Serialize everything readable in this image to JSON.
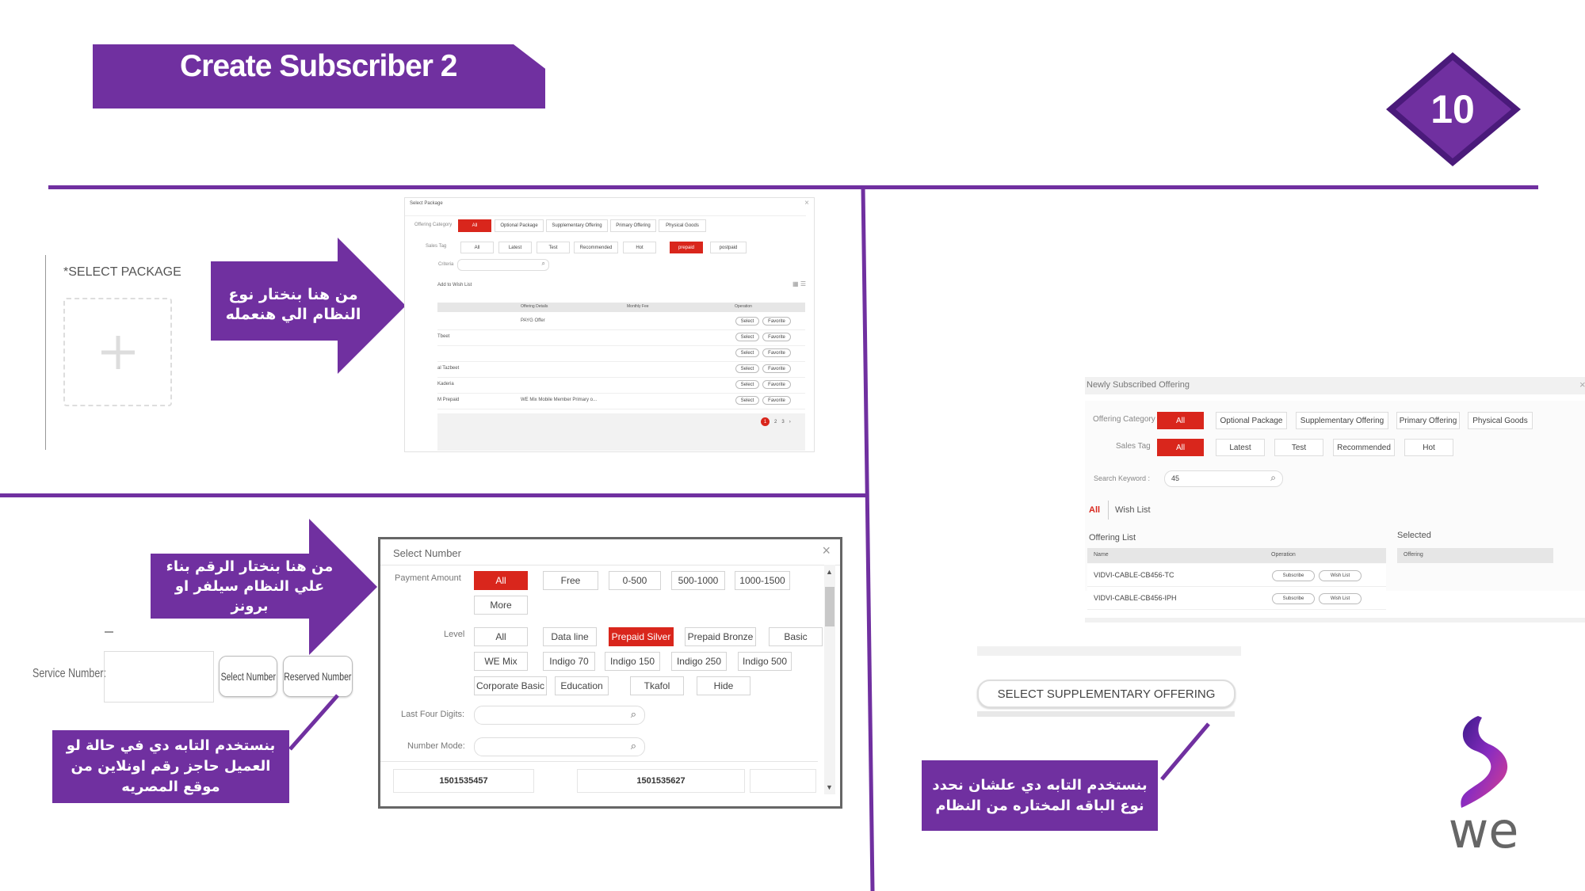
{
  "slide": {
    "title": "Create Subscriber 2",
    "page_number": "10",
    "brand_logo_text": "we",
    "colors": {
      "accent": "#7030a0",
      "red": "#d9261c"
    }
  },
  "select_package": {
    "label": "*SELECT PACKAGE",
    "arrow_note": "من هنا بنختار نوع النظام الي هنعمله"
  },
  "package_dialog": {
    "title": "Select Package",
    "offering_category_label": "Offering Category",
    "offering_categories": [
      "All",
      "Optional Package",
      "Supplementary Offering",
      "Primary Offering",
      "Physical Goods"
    ],
    "sales_tag_label": "Sales Tag",
    "sales_tags": [
      "All",
      "Latest",
      "Test",
      "Recommended",
      "Hot",
      "prepaid",
      "postpaid"
    ],
    "criteria_label": "Criteria",
    "add_to_wish_list": "Add to Wish List",
    "columns": [
      "Offering Details",
      "Monthly Fee",
      "Operation"
    ],
    "rows": [
      {
        "name": "",
        "details": "PAYG Offer"
      },
      {
        "name": "Tbeet",
        "details": ""
      },
      {
        "name": "",
        "details": ""
      },
      {
        "name": "al Tazbeet",
        "details": ""
      },
      {
        "name": "Kaderia",
        "details": ""
      },
      {
        "name": "M Prepaid",
        "details": "WE Mix Mobile Member Primary o..."
      }
    ],
    "row_buttons": [
      "Select",
      "Favorite"
    ],
    "pages": [
      "1",
      "2",
      "3"
    ]
  },
  "service_number": {
    "label": "Service Number:",
    "select_number_btn": "Select Number",
    "reserved_number_btn": "Reserved Number",
    "arrow_note": "من هنا بنختار الرقم بناء علي النظام سيلفر او برونز",
    "note": "بنستخدم التابه دي في حالة لو العميل حاجز رقم اونلاين من موقع المصريه"
  },
  "number_dialog": {
    "title": "Select Number",
    "payment_amount_label": "Payment Amount",
    "payment_amounts": [
      "All",
      "Free",
      "0-500",
      "500-1000",
      "1000-1500",
      "More"
    ],
    "level_label": "Level",
    "levels": [
      "All",
      "Data line",
      "Prepaid Silver",
      "Prepaid Bronze",
      "Basic",
      "WE Mix",
      "Indigo 70",
      "Indigo 150",
      "Indigo 250",
      "Indigo 500",
      "Corporate Basic",
      "Education",
      "Tkafol",
      "Hide"
    ],
    "last_four_label": "Last Four Digits:",
    "number_mode_label": "Number Mode:",
    "numbers": [
      "1501535457",
      "1501535627"
    ]
  },
  "offering_dialog": {
    "title": "Newly Subscribed Offering",
    "offering_category_label": "Offering Category",
    "offering_categories": [
      "All",
      "Optional Package",
      "Supplementary Offering",
      "Primary Offering",
      "Physical Goods"
    ],
    "sales_tag_label": "Sales Tag",
    "sales_tags": [
      "All",
      "Latest",
      "Test",
      "Recommended",
      "Hot"
    ],
    "search_label": "Search Keyword :",
    "search_value": "45",
    "tabs": [
      "All",
      "Wish List"
    ],
    "offering_list_label": "Offering List",
    "selected_label": "Selected",
    "columns": [
      "Name",
      "Operation"
    ],
    "selected_column": "Offering",
    "rows": [
      "VIDVI-CABLE-CB456-TC",
      "VIDVI-CABLE-CB456-IPH"
    ],
    "row_buttons": [
      "Subscribe",
      "Wish List"
    ]
  },
  "supplementary": {
    "button_label": "SELECT SUPPLEMENTARY OFFERING",
    "note": "بنستخدم التابه دي علشان نحدد نوع الباقه المختاره من النظام"
  }
}
